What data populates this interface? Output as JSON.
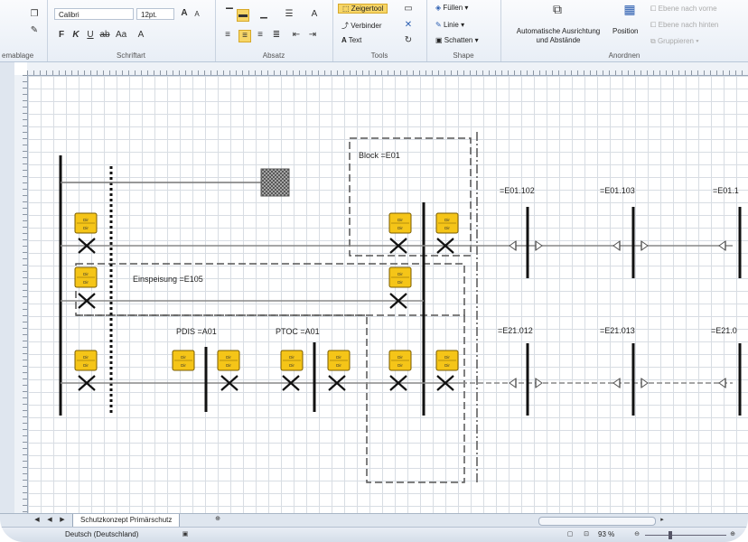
{
  "ribbon": {
    "clipboard": {
      "label": "emablage"
    },
    "font": {
      "name": "Calibri",
      "size": "12pt.",
      "bold": "F",
      "italic": "K",
      "underline": "U",
      "label": "Schriftart"
    },
    "paragraph": {
      "label": "Absatz"
    },
    "tools": {
      "pointer": "Zeigertool",
      "connector": "Verbinder",
      "text": "Text",
      "label": "Tools"
    },
    "shape": {
      "fill": "Füllen",
      "line": "Linie",
      "shadow": "Schatten",
      "label": "Shape"
    },
    "arrange": {
      "auto_line1": "Automatische Ausrichtung",
      "auto_line2": "und Abstände",
      "position": "Position",
      "bring_forward": "Ebene nach vorne",
      "send_back": "Ebene nach hinten",
      "group": "Gruppieren",
      "label": "Anordnen"
    }
  },
  "diagram": {
    "block_label": "Block =E01",
    "feed_label": "Einspeisung =E105",
    "pdis_label": "PDIS =A01",
    "ptoc_label": "PTOC =A01",
    "top_labels": [
      "=E01.102",
      "=E01.103",
      "=E01.1"
    ],
    "bottom_labels": [
      "=E21.012",
      "=E21.013",
      "=E21.0"
    ],
    "relay_text": "Dir",
    "colors": {
      "relay_fill": "#f5c518",
      "relay_stroke": "#7a5c00",
      "line": "#111111",
      "grid": "#d8dde3",
      "accent": "#f7d667"
    }
  },
  "tabs": {
    "page": "Schutzkonzept Primärschutz"
  },
  "status": {
    "language": "Deutsch (Deutschland)",
    "zoom": "93 %"
  }
}
